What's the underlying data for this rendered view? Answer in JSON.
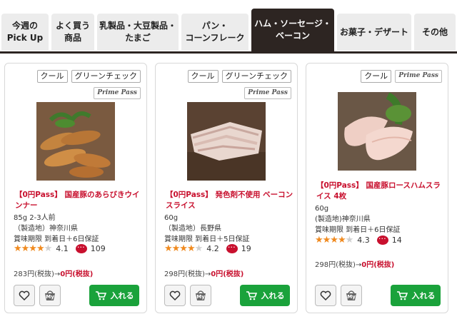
{
  "tabs": [
    {
      "label": "今週の\nPick Up"
    },
    {
      "label": "よく買う\n商品"
    },
    {
      "label": "乳製品・大豆製品・\nたまご"
    },
    {
      "label": "パン・\nコーンフレーク"
    },
    {
      "label": "ハム・ソーセージ・\nベーコン"
    },
    {
      "label": "お菓子・デザート"
    },
    {
      "label": "その他"
    }
  ],
  "cards": [
    {
      "tags": [
        "クール",
        "グリーンチェック"
      ],
      "prime": "Prime Pass",
      "title": "【0円Pass】 国産豚のあらびきウインナー",
      "line1": "85g 2-3人前",
      "line2": "（製造地）神奈川県",
      "line3": "賞味期限 到着日＋6日保証",
      "rating": "4.1",
      "stars": 4,
      "reviews": "109",
      "price_base": "283円(税抜)→",
      "price_zero": "0円(税抜)",
      "cart_label": "入れる",
      "my_label": "My"
    },
    {
      "tags": [
        "クール",
        "グリーンチェック"
      ],
      "prime": "Prime Pass",
      "title": "【0円Pass】 発色剤不使用 ベーコンスライス",
      "line1": "60g",
      "line2": "（製造地）長野県",
      "line3": "賞味期限 到着日＋5日保証",
      "rating": "4.2",
      "stars": 4,
      "reviews": "19",
      "price_base": "298円(税抜)→",
      "price_zero": "0円(税抜)",
      "cart_label": "入れる",
      "my_label": "My"
    },
    {
      "tags": [
        "クール"
      ],
      "prime": "Prime Pass",
      "title": "【0円Pass】 国産豚ロースハムスライス 4枚",
      "line1": "60g",
      "line2": "(製造地)神奈川県",
      "line3": "賞味期限 到着日＋6日保証",
      "rating": "4.3",
      "stars": 4,
      "reviews": "14",
      "price_base": "298円(税抜)→",
      "price_zero": "0円(税抜)",
      "cart_label": "入れる",
      "my_label": "My"
    }
  ],
  "colors": {
    "active_tab": "#2d2522",
    "accent_red": "#c8102e",
    "cart_green": "#1aa23b",
    "star": "#f08a1f"
  }
}
